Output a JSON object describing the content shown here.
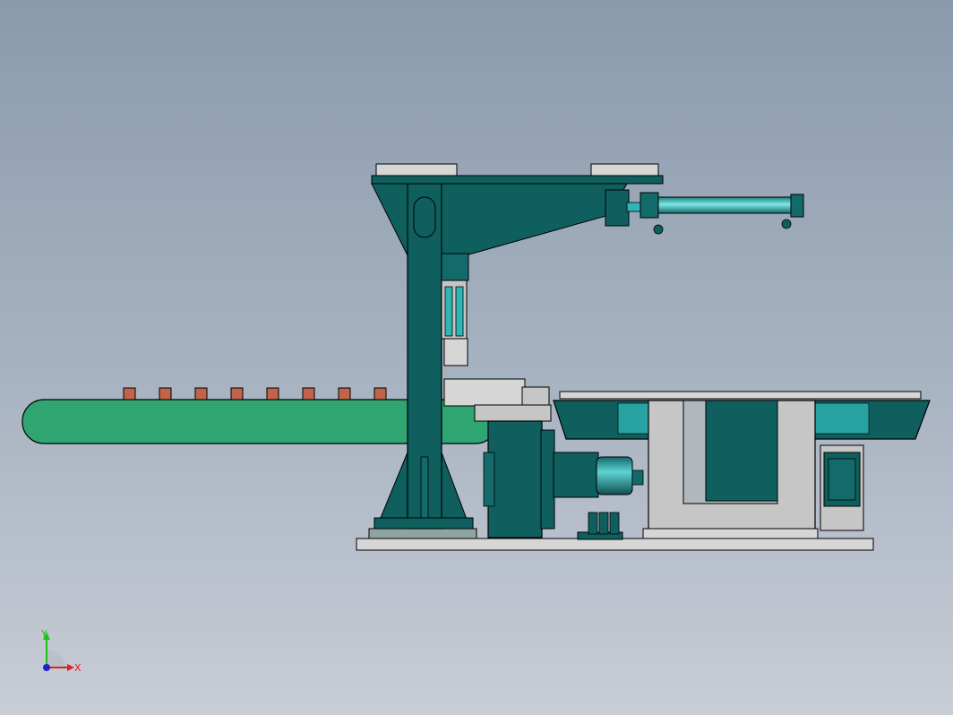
{
  "triad": {
    "x_label": "X",
    "y_label": "Y",
    "x_color": "#e02020",
    "y_color": "#20c020",
    "z_color": "#2020d0"
  },
  "colors": {
    "frame_teal": "#0f5f5f",
    "conveyor_green": "#2fa572",
    "product_block": "#c0644b",
    "cylinder_cyan": "#2fb5b5",
    "stand_grey": "#c6c6c6",
    "outline": "#000000"
  }
}
